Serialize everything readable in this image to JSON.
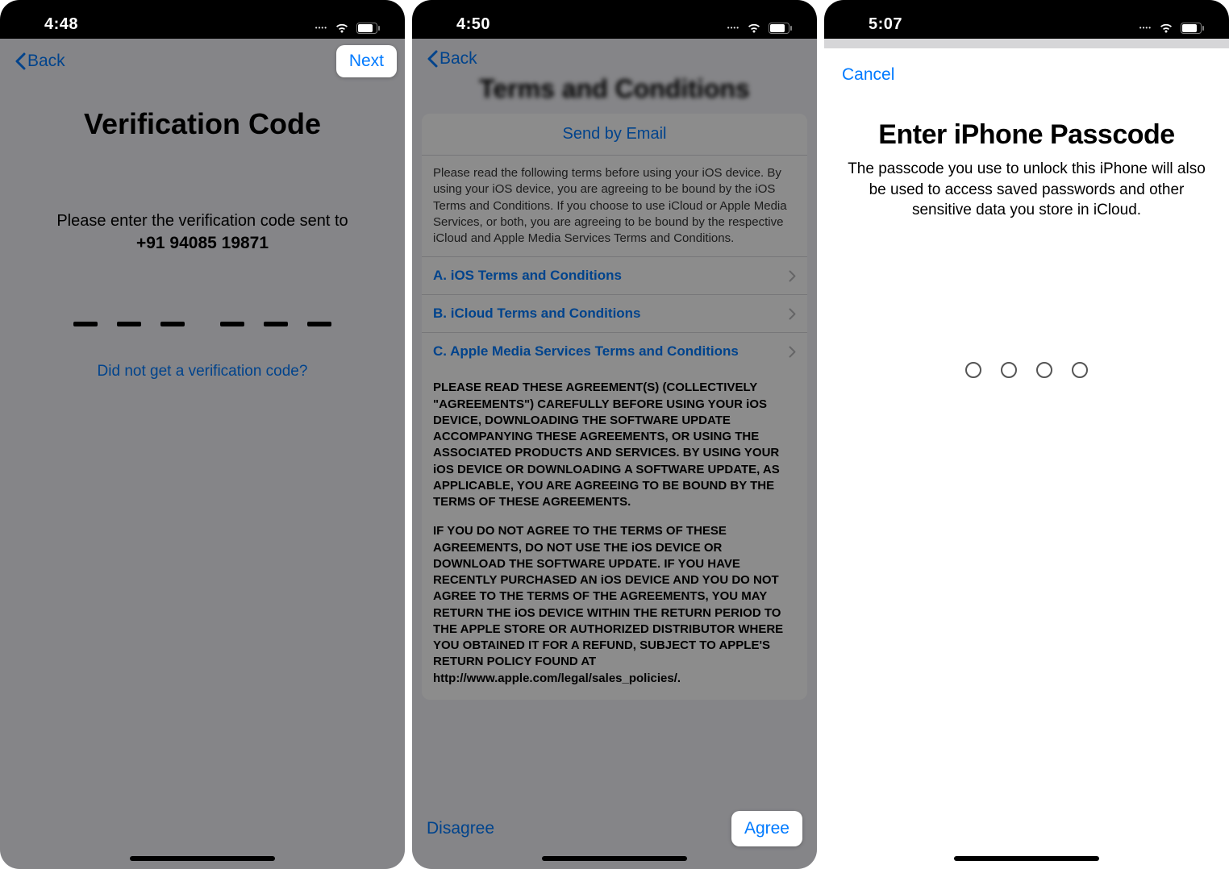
{
  "screen1": {
    "time": "4:48",
    "back_label": "Back",
    "next_label": "Next",
    "title": "Verification Code",
    "prompt": "Please enter the verification code sent to",
    "phone": "+91 94085 19871",
    "resend_label": "Did not get a verification code?"
  },
  "screen2": {
    "time": "4:50",
    "back_label": "Back",
    "title": "Terms and Conditions",
    "send_email": "Send by Email",
    "intro": "Please read the following terms before using your iOS device. By using your iOS device, you are agreeing to be bound by the iOS Terms and Conditions. If you choose to use iCloud or Apple Media Services, or both, you are agreeing to be bound by the respective iCloud and Apple Media Services Terms and Conditions.",
    "rows": {
      "a": "A. iOS Terms and Conditions",
      "b": "B. iCloud Terms and Conditions",
      "c": "C. Apple Media Services Terms and Conditions"
    },
    "para1": "PLEASE READ THESE AGREEMENT(S) (COLLECTIVELY \"AGREEMENTS\") CAREFULLY BEFORE USING YOUR iOS DEVICE, DOWNLOADING THE SOFTWARE UPDATE ACCOMPANYING THESE AGREEMENTS, OR USING THE ASSOCIATED PRODUCTS AND SERVICES. BY USING YOUR iOS DEVICE OR DOWNLOADING A SOFTWARE UPDATE, AS APPLICABLE, YOU ARE AGREEING TO BE BOUND BY THE TERMS OF THESE AGREEMENTS.",
    "para2": "IF YOU DO NOT AGREE TO THE TERMS OF THESE AGREEMENTS, DO NOT USE THE iOS DEVICE OR DOWNLOAD THE SOFTWARE UPDATE. IF YOU HAVE RECENTLY PURCHASED AN iOS DEVICE AND YOU DO NOT AGREE TO THE TERMS OF THE AGREEMENTS, YOU MAY RETURN THE iOS DEVICE WITHIN THE RETURN PERIOD TO THE APPLE STORE OR AUTHORIZED DISTRIBUTOR WHERE YOU OBTAINED IT FOR A REFUND, SUBJECT TO APPLE'S RETURN POLICY FOUND AT http://www.apple.com/legal/sales_policies/.",
    "disagree": "Disagree",
    "agree": "Agree"
  },
  "screen3": {
    "time": "5:07",
    "cancel": "Cancel",
    "title": "Enter iPhone Passcode",
    "desc": "The passcode you use to unlock this iPhone will also be used to access saved passwords and other sensitive data you store in iCloud."
  }
}
